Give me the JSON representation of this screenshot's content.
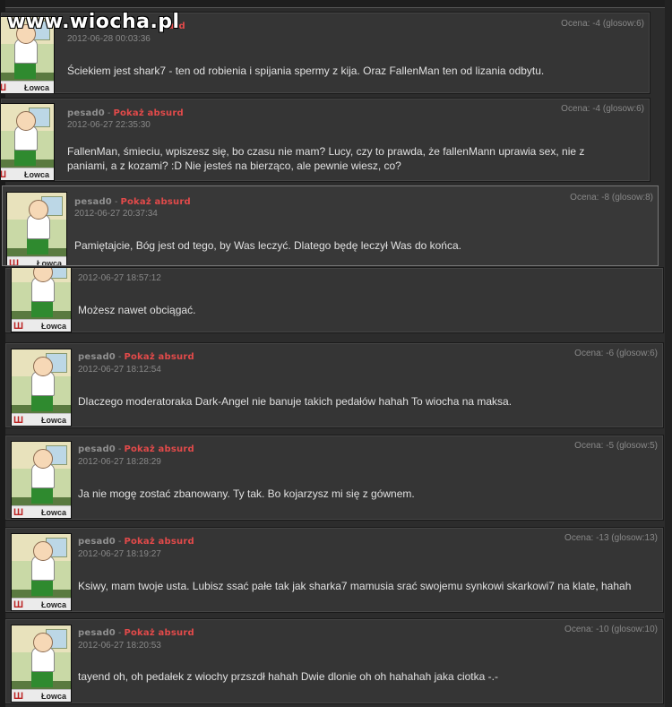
{
  "watermark": "www.wiocha.pl",
  "rank_label": "Łowca",
  "comments": [
    {
      "author": "",
      "absurd": "urd",
      "date": "2012-06-28 00:03:36",
      "score": "Ocena: -4 (glosow:6)",
      "text": "Ściekiem jest shark7 - ten od robienia i spijania spermy z kija. Oraz FallenMan ten od lizania odbytu."
    },
    {
      "author": "pesad0",
      "absurd": "Pokaż absurd",
      "date": "2012-06-27 22:35:30",
      "score": "Ocena: -4 (glosow:6)",
      "text": "FallenMan, śmieciu, wpiszesz się, bo czasu nie mam? Lucy, czy to prawda, że fallenMann uprawia sex, nie z paniami, a z kozami? :D Nie jesteś na bierząco, ale pewnie wiesz, co?"
    },
    {
      "author": "pesad0",
      "absurd": "Pokaż absurd",
      "date": "2012-06-27 20:37:34",
      "score": "Ocena: -8 (glosow:8)",
      "text": "Pamiętajcie, Bóg jest od tego, by Was leczyć. Dlatego będę leczył Was do końca."
    },
    {
      "author": "",
      "absurd": "",
      "date": "2012-06-27 18:57:12",
      "score": "",
      "text": "Możesz nawet obciągać."
    },
    {
      "author": "pesad0",
      "absurd": "Pokaż absurd",
      "date": "2012-06-27 18:12:54",
      "score": "Ocena: -6 (glosow:6)",
      "text": "Dlaczego moderatoraka Dark-Angel nie banuje takich pedałów hahah To wiocha na maksa."
    },
    {
      "author": "pesad0",
      "absurd": "Pokaż absurd",
      "date": "2012-06-27 18:28:29",
      "score": "Ocena: -5 (glosow:5)",
      "text": "Ja nie mogę zostać zbanowany. Ty tak. Bo kojarzysz mi się z gównem."
    },
    {
      "author": "pesad0",
      "absurd": "Pokaż absurd",
      "date": "2012-06-27 18:19:27",
      "score": "Ocena: -13 (glosow:13)",
      "text": "Ksiwy, mam twoje usta. Lubisz ssać pałe tak jak sharka7 mamusia srać swojemu synkowi skarkowi7 na klate, hahah"
    },
    {
      "author": "pesad0",
      "absurd": "Pokaż absurd",
      "date": "2012-06-27 18:20:53",
      "score": "Ocena: -10 (glosow:10)",
      "text": "tayend oh, oh pedałek z wiochy przszdł hahah Dwie dlonie oh oh hahahah jaka ciotka -.-"
    }
  ]
}
